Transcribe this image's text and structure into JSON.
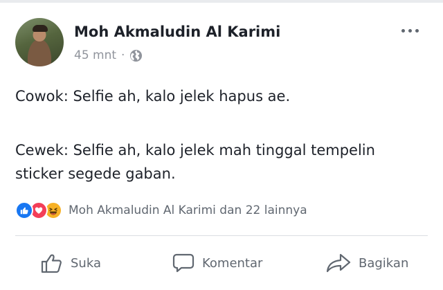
{
  "post": {
    "author": "Moh Akmaludin Al Karimi",
    "time": "45 mnt",
    "separator": "·",
    "privacy_icon": "globe-icon",
    "more_icon": "more-options-icon",
    "text_paragraph_1": "Cowok: Selfie ah, kalo jelek hapus ae.",
    "text_paragraph_2_line_1": "Cewek: Selfie ah, kalo jelek mah tinggal tempelin",
    "text_paragraph_2_line_2": "sticker segede gaban."
  },
  "reactions": {
    "icons": [
      "like-reaction-icon",
      "love-reaction-icon",
      "haha-reaction-icon"
    ],
    "summary": "Moh Akmaludin Al Karimi dan 22 lainnya"
  },
  "actions": {
    "like_label": "Suka",
    "comment_label": "Komentar",
    "share_label": "Bagikan"
  },
  "colors": {
    "like_blue": "#1877f2",
    "love_red": "#f33e58",
    "haha_yellow": "#f7b125",
    "secondary_text": "#606770"
  }
}
